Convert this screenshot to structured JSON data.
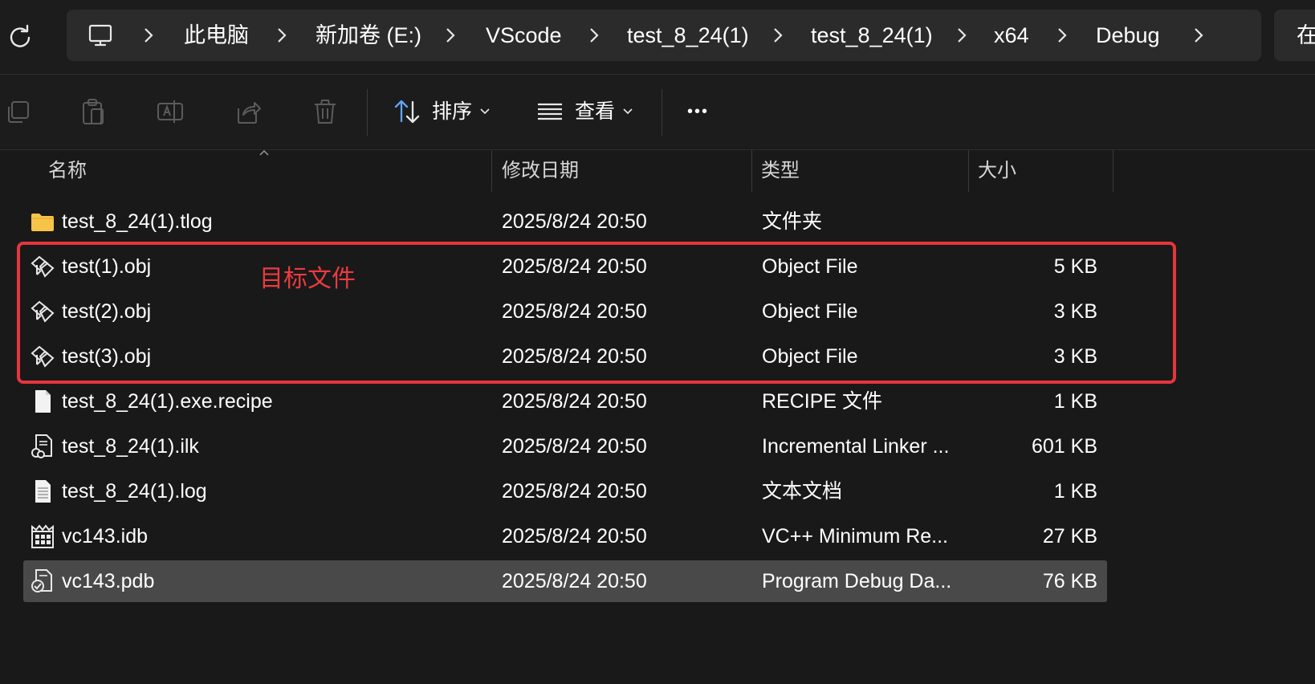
{
  "breadcrumb": {
    "items": [
      "此电脑",
      "新加卷 (E:)",
      "VScode",
      "test_8_24(1)",
      "test_8_24(1)",
      "x64",
      "Debug"
    ],
    "search_fragment": "在"
  },
  "toolbar": {
    "sort_label": "排序",
    "view_label": "查看",
    "more_label": "•••"
  },
  "columns": {
    "name": "名称",
    "date": "修改日期",
    "type": "类型",
    "size": "大小"
  },
  "files": [
    {
      "name": "test_8_24(1).tlog",
      "date": "2025/8/24 20:50",
      "type": "文件夹",
      "size": "",
      "icon": "folder-icon"
    },
    {
      "name": "test(1).obj",
      "date": "2025/8/24 20:50",
      "type": "Object File",
      "size": "5 KB",
      "icon": "obj-file-icon"
    },
    {
      "name": "test(2).obj",
      "date": "2025/8/24 20:50",
      "type": "Object File",
      "size": "3 KB",
      "icon": "obj-file-icon"
    },
    {
      "name": "test(3).obj",
      "date": "2025/8/24 20:50",
      "type": "Object File",
      "size": "3 KB",
      "icon": "obj-file-icon"
    },
    {
      "name": "test_8_24(1).exe.recipe",
      "date": "2025/8/24 20:50",
      "type": "RECIPE 文件",
      "size": "1 KB",
      "icon": "blank-file-icon"
    },
    {
      "name": "test_8_24(1).ilk",
      "date": "2025/8/24 20:50",
      "type": "Incremental Linker ...",
      "size": "601 KB",
      "icon": "ilk-file-icon"
    },
    {
      "name": "test_8_24(1).log",
      "date": "2025/8/24 20:50",
      "type": "文本文档",
      "size": "1 KB",
      "icon": "text-file-icon"
    },
    {
      "name": "vc143.idb",
      "date": "2025/8/24 20:50",
      "type": "VC++ Minimum Re...",
      "size": "27 KB",
      "icon": "idb-file-icon"
    },
    {
      "name": "vc143.pdb",
      "date": "2025/8/24 20:50",
      "type": "Program Debug Da...",
      "size": "76 KB",
      "icon": "pdb-file-icon",
      "selected": true
    }
  ],
  "annotation": {
    "label": "目标文件",
    "color": "#e6353d"
  },
  "colors": {
    "background": "#191919",
    "address_bar": "#2b2b2b",
    "selected_row": "#494949",
    "folder": "#f7c44a",
    "accent_blue": "#60a5fa"
  }
}
